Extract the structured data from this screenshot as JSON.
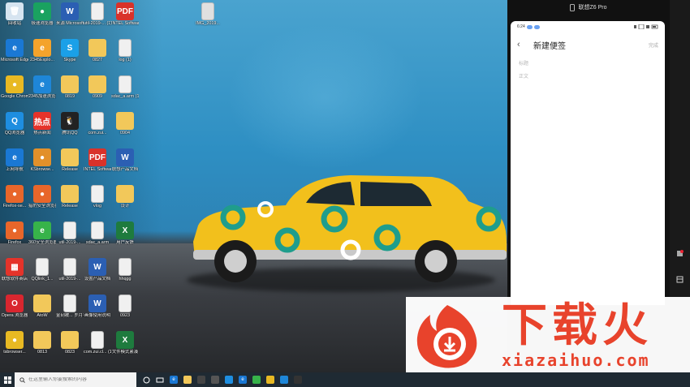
{
  "desktop": {
    "icons": [
      {
        "label": "回收站",
        "x": 0,
        "y": 0,
        "color": "#d6e4f0",
        "glyph": "🗑",
        "name": "recycle-bin-icon"
      },
      {
        "label": "极速浏览器",
        "x": 1,
        "y": 0,
        "color": "#1aa260",
        "glyph": "●",
        "name": "browser-icon"
      },
      {
        "label": "来源 Microsoft...",
        "x": 2,
        "y": 0,
        "color": "#2b5fb3",
        "glyph": "W",
        "name": "word-icon"
      },
      {
        "label": "util-2019-... (1)",
        "x": 3,
        "y": 0,
        "color": "#f0f0f0",
        "glyph": "",
        "name": "file-icon"
      },
      {
        "label": "INTEL Software...",
        "x": 4,
        "y": 0,
        "color": "#d9322a",
        "glyph": "PDF",
        "name": "pdf-icon"
      },
      {
        "label": "Microsoft Edge",
        "x": 0,
        "y": 1,
        "color": "#1a78d4",
        "glyph": "e",
        "name": "edge-icon"
      },
      {
        "label": "2345Explo...",
        "x": 1,
        "y": 1,
        "color": "#f4a32b",
        "glyph": "e",
        "name": "browser-icon"
      },
      {
        "label": "Skype",
        "x": 2,
        "y": 1,
        "color": "#1aa0e8",
        "glyph": "S",
        "name": "skype-icon"
      },
      {
        "label": "0827",
        "x": 3,
        "y": 1,
        "color": "#f2c85a",
        "glyph": "",
        "name": "folder-icon"
      },
      {
        "label": "log (1)",
        "x": 4,
        "y": 1,
        "color": "#f0f0f0",
        "glyph": "",
        "name": "file-icon"
      },
      {
        "label": "Google Chrome",
        "x": 0,
        "y": 2,
        "color": "#e8b923",
        "glyph": "●",
        "name": "chrome-icon"
      },
      {
        "label": "2345加速浏览器",
        "x": 1,
        "y": 2,
        "color": "#1e86d8",
        "glyph": "e",
        "name": "browser-icon"
      },
      {
        "label": "0819",
        "x": 2,
        "y": 2,
        "color": "#f2c85a",
        "glyph": "",
        "name": "folder-icon"
      },
      {
        "label": "0909",
        "x": 3,
        "y": 2,
        "color": "#f2c85a",
        "glyph": "",
        "name": "folder-icon"
      },
      {
        "label": "sdac_a.arm (1)",
        "x": 4,
        "y": 2,
        "color": "#f0f0f0",
        "glyph": "",
        "name": "file-icon"
      },
      {
        "label": "QQ浏览器",
        "x": 0,
        "y": 3,
        "color": "#1e8ee0",
        "glyph": "Q",
        "name": "qq-browser-icon"
      },
      {
        "label": "热点新闻",
        "x": 1,
        "y": 3,
        "color": "#e5332a",
        "glyph": "热点",
        "name": "news-icon"
      },
      {
        "label": "腾讯QQ",
        "x": 2,
        "y": 3,
        "color": "#222",
        "glyph": "🐧",
        "name": "qq-icon"
      },
      {
        "label": "com.zui...",
        "x": 3,
        "y": 3,
        "color": "#f0f0f0",
        "glyph": "",
        "name": "file-icon"
      },
      {
        "label": "0904",
        "x": 4,
        "y": 3,
        "color": "#f2c85a",
        "glyph": "",
        "name": "folder-icon"
      },
      {
        "label": "上网导航",
        "x": 0,
        "y": 4,
        "color": "#1a78d4",
        "glyph": "e",
        "name": "ie-icon"
      },
      {
        "label": "KSbrowse...",
        "x": 1,
        "y": 4,
        "color": "#e2902a",
        "glyph": "●",
        "name": "browser-icon"
      },
      {
        "label": "Release",
        "x": 2,
        "y": 4,
        "color": "#f2c85a",
        "glyph": "",
        "name": "folder-icon"
      },
      {
        "label": "INTEL Software...",
        "x": 3,
        "y": 4,
        "color": "#d9322a",
        "glyph": "PDF",
        "name": "pdf-icon"
      },
      {
        "label": "联想产品文档",
        "x": 4,
        "y": 4,
        "color": "#2b5fb3",
        "glyph": "W",
        "name": "word-icon"
      },
      {
        "label": "Firefox-se...",
        "x": 0,
        "y": 5,
        "color": "#e8662a",
        "glyph": "●",
        "name": "firefox-icon"
      },
      {
        "label": "猎豹安全浏览器",
        "x": 1,
        "y": 5,
        "color": "#e8662a",
        "glyph": "●",
        "name": "browser-icon"
      },
      {
        "label": "Release",
        "x": 2,
        "y": 5,
        "color": "#f2c85a",
        "glyph": "",
        "name": "folder-icon"
      },
      {
        "label": "vlog",
        "x": 3,
        "y": 5,
        "color": "#f0f0f0",
        "glyph": "",
        "name": "file-icon"
      },
      {
        "label": "设计",
        "x": 4,
        "y": 5,
        "color": "#f2c85a",
        "glyph": "",
        "name": "folder-icon"
      },
      {
        "label": "Firefox",
        "x": 0,
        "y": 6,
        "color": "#e8662a",
        "glyph": "●",
        "name": "firefox-icon"
      },
      {
        "label": "360安全浏览器",
        "x": 1,
        "y": 6,
        "color": "#37b34a",
        "glyph": "e",
        "name": "browser-icon"
      },
      {
        "label": "util-2019-...",
        "x": 2,
        "y": 6,
        "color": "#f0f0f0",
        "glyph": "",
        "name": "file-icon"
      },
      {
        "label": "sdac_a.arm",
        "x": 3,
        "y": 6,
        "color": "#f0f0f0",
        "glyph": "",
        "name": "file-icon"
      },
      {
        "label": "用户反馈",
        "x": 4,
        "y": 6,
        "color": "#1e7b3e",
        "glyph": "X",
        "name": "excel-icon"
      },
      {
        "label": "联想软件商店",
        "x": 0,
        "y": 7,
        "color": "#e5332a",
        "glyph": "▦",
        "name": "store-icon"
      },
      {
        "label": "QQlink_1...",
        "x": 1,
        "y": 7,
        "color": "#f0f0f0",
        "glyph": "",
        "name": "file-icon"
      },
      {
        "label": "util-2019-...",
        "x": 2,
        "y": 7,
        "color": "#f0f0f0",
        "glyph": "",
        "name": "file-icon"
      },
      {
        "label": "设置产品文档",
        "x": 3,
        "y": 7,
        "color": "#2b5fb3",
        "glyph": "W",
        "name": "word-icon"
      },
      {
        "label": "hhqgg",
        "x": 4,
        "y": 7,
        "color": "#f0f0f0",
        "glyph": "",
        "name": "file-icon"
      },
      {
        "label": "Opera 浏览器",
        "x": 0,
        "y": 8,
        "color": "#d9262f",
        "glyph": "O",
        "name": "opera-icon"
      },
      {
        "label": "AtoW",
        "x": 1,
        "y": 8,
        "color": "#f2c85a",
        "glyph": "",
        "name": "folder-icon"
      },
      {
        "label": "金刻被... 岁月神偷(3)...",
        "x": 2,
        "y": 8,
        "color": "#f0f0f0",
        "glyph": "",
        "name": "file-icon"
      },
      {
        "label": "画像使用说明",
        "x": 3,
        "y": 8,
        "color": "#2b5fb3",
        "glyph": "W",
        "name": "word-icon"
      },
      {
        "label": "0923",
        "x": 4,
        "y": 8,
        "color": "#f0f0f0",
        "glyph": "",
        "name": "file-icon"
      },
      {
        "label": "tsbrowser...",
        "x": 0,
        "y": 9,
        "color": "#e8b923",
        "glyph": "●",
        "name": "browser-icon"
      },
      {
        "label": "0813",
        "x": 1,
        "y": 9,
        "color": "#f2c85a",
        "glyph": "",
        "name": "folder-icon"
      },
      {
        "label": "0823",
        "x": 2,
        "y": 9,
        "color": "#f2c85a",
        "glyph": "",
        "name": "folder-icon"
      },
      {
        "label": "com.zui.cl... (1)",
        "x": 3,
        "y": 9,
        "color": "#f0f0f0",
        "glyph": "",
        "name": "file-icon"
      },
      {
        "label": "文件模式紧凑",
        "x": 4,
        "y": 9,
        "color": "#1e7b3e",
        "glyph": "X",
        "name": "excel-icon"
      },
      {
        "label": "IMG_2019...",
        "x": 7,
        "y": 0,
        "color": "#e0e0e0",
        "glyph": "",
        "name": "image-file-icon"
      }
    ]
  },
  "phone": {
    "device_name": "联想Z6 Pro",
    "time": "6:24",
    "note": {
      "back": "‹",
      "title": "新建便签",
      "done": "完成",
      "title_placeholder": "标题",
      "body_placeholder": "正文"
    }
  },
  "watermark": {
    "brand": "下载火",
    "url": "xiazaihuo.com"
  },
  "taskbar": {
    "search_placeholder": "在这里输入你要搜索的内容"
  },
  "colors": {
    "taskbar": "#1f2a33",
    "watermark": "#e8432c",
    "car": "#f2c01c"
  }
}
